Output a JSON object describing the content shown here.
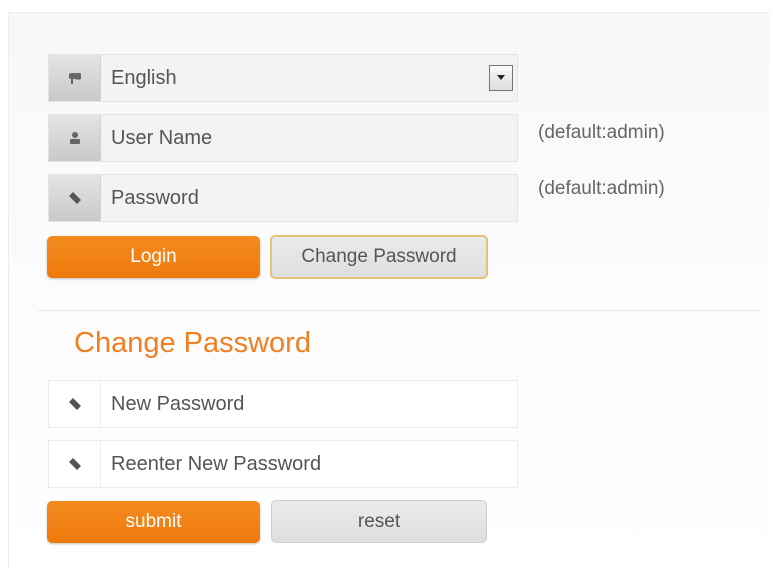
{
  "login": {
    "language": {
      "value": "English",
      "icon": "flag-icon"
    },
    "username": {
      "placeholder": "User Name",
      "hint": "(default:admin)",
      "icon": "user-icon"
    },
    "password": {
      "placeholder": "Password",
      "hint": "(default:admin)",
      "icon": "tag-icon"
    },
    "login_label": "Login",
    "change_password_label": "Change Password"
  },
  "change_password": {
    "title": "Change Password",
    "new_password_placeholder": "New Password",
    "reenter_placeholder": "Reenter New Password",
    "submit_label": "submit",
    "reset_label": "reset"
  },
  "colors": {
    "accent": "#f07f22",
    "button_orange": "#f48b1f",
    "focus_border": "#e2c277"
  }
}
